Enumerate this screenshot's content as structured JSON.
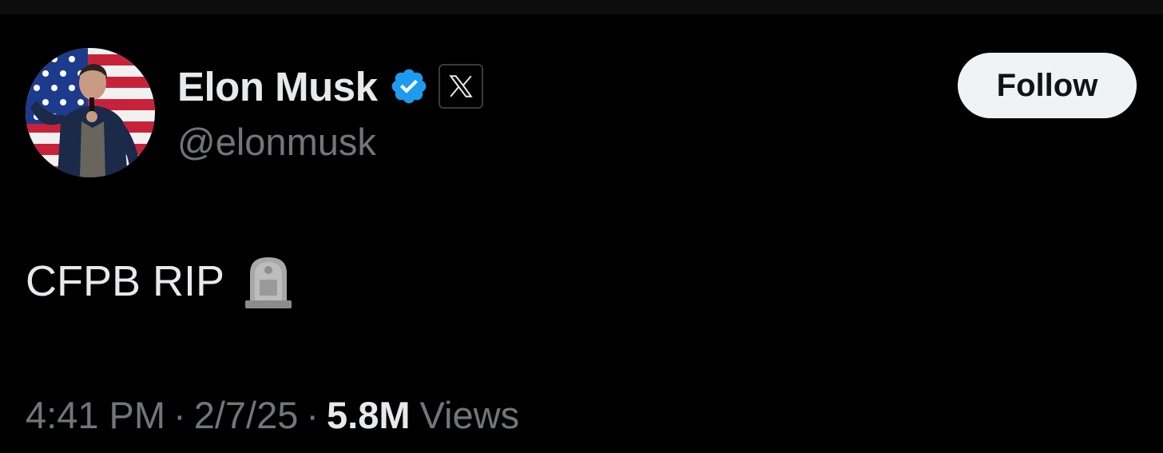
{
  "author": {
    "name": "Elon Musk",
    "handle": "@elonmusk",
    "avatar_icon": "profile-photo",
    "verified_icon": "verified-badge-icon",
    "verified_color": "#1d9bf0",
    "affiliate_icon": "x-logo-icon"
  },
  "follow_button": {
    "label": "Follow"
  },
  "tweet": {
    "text": "CFPB RIP",
    "emoji_icon": "headstone-icon"
  },
  "meta": {
    "time": "4:41 PM",
    "separator": "·",
    "date": "2/7/25",
    "views_count": "5.8M",
    "views_label": "Views"
  },
  "colors": {
    "background": "#000000",
    "primary_text": "#e7e9ea",
    "secondary_text": "#71767b",
    "button_bg": "#eff3f4"
  }
}
